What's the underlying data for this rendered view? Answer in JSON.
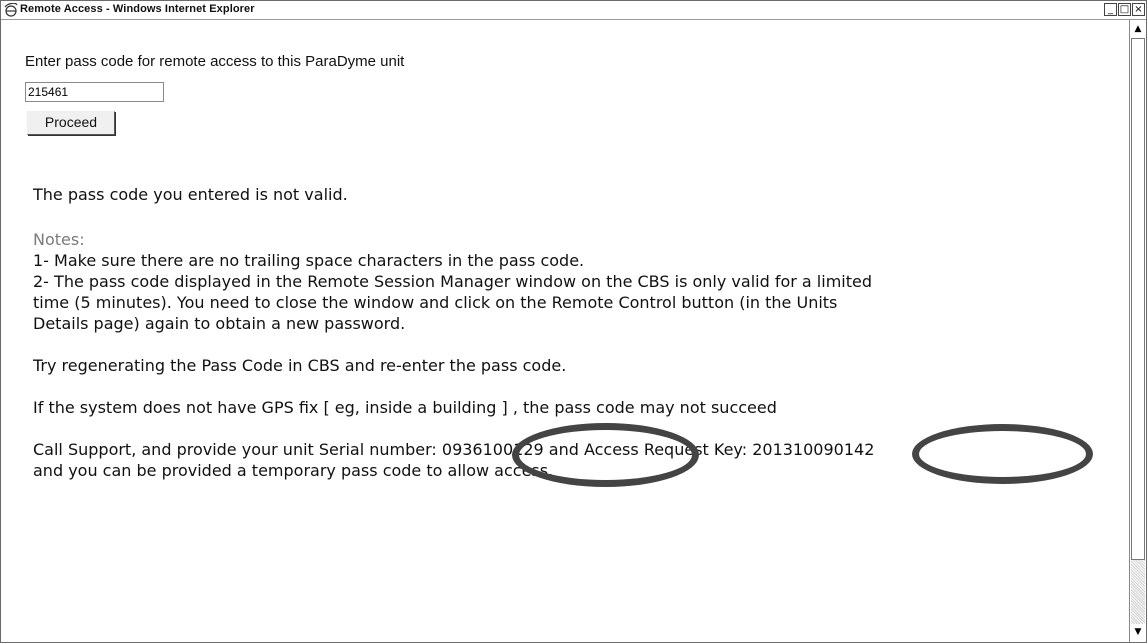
{
  "window": {
    "title": "Remote Access - Windows Internet Explorer",
    "minimize": "_",
    "maximize": "□",
    "close": "×",
    "icon": "ie-icon"
  },
  "form": {
    "prompt": "Enter pass code for remote access to this ParaDyme unit",
    "passcode_value": "215461",
    "proceed_label": "Proceed"
  },
  "messages": {
    "invalid": "The pass code you entered is not valid.",
    "notes_label": "Notes:",
    "note1": "1- Make sure there are no trailing space characters in the pass code.",
    "note2_line1": "2- The pass code displayed in the Remote Session Manager window on the CBS is only valid for a limited",
    "note2_line2": "time (5 minutes). You need to close the window and click on the Remote Control button (in the Units",
    "note2_line3": "Details page) again to obtain a new password.",
    "retry": "Try regenerating the Pass Code in CBS and re-enter the pass code.",
    "gps": "If the system does not have GPS fix [ eg, inside a building ] , the pass code may not succeed",
    "support_line1": "Call Support, and provide your unit Serial number: 0936100129 and Access Request Key: 201310090142",
    "support_line2": "and you can be provided a temporary pass code to allow access."
  },
  "scrollbar": {
    "up_arrow": "▲",
    "down_arrow": "▼"
  },
  "colors": {
    "annotation_circle": "#444444",
    "notes_label": "#7a7a7a"
  }
}
